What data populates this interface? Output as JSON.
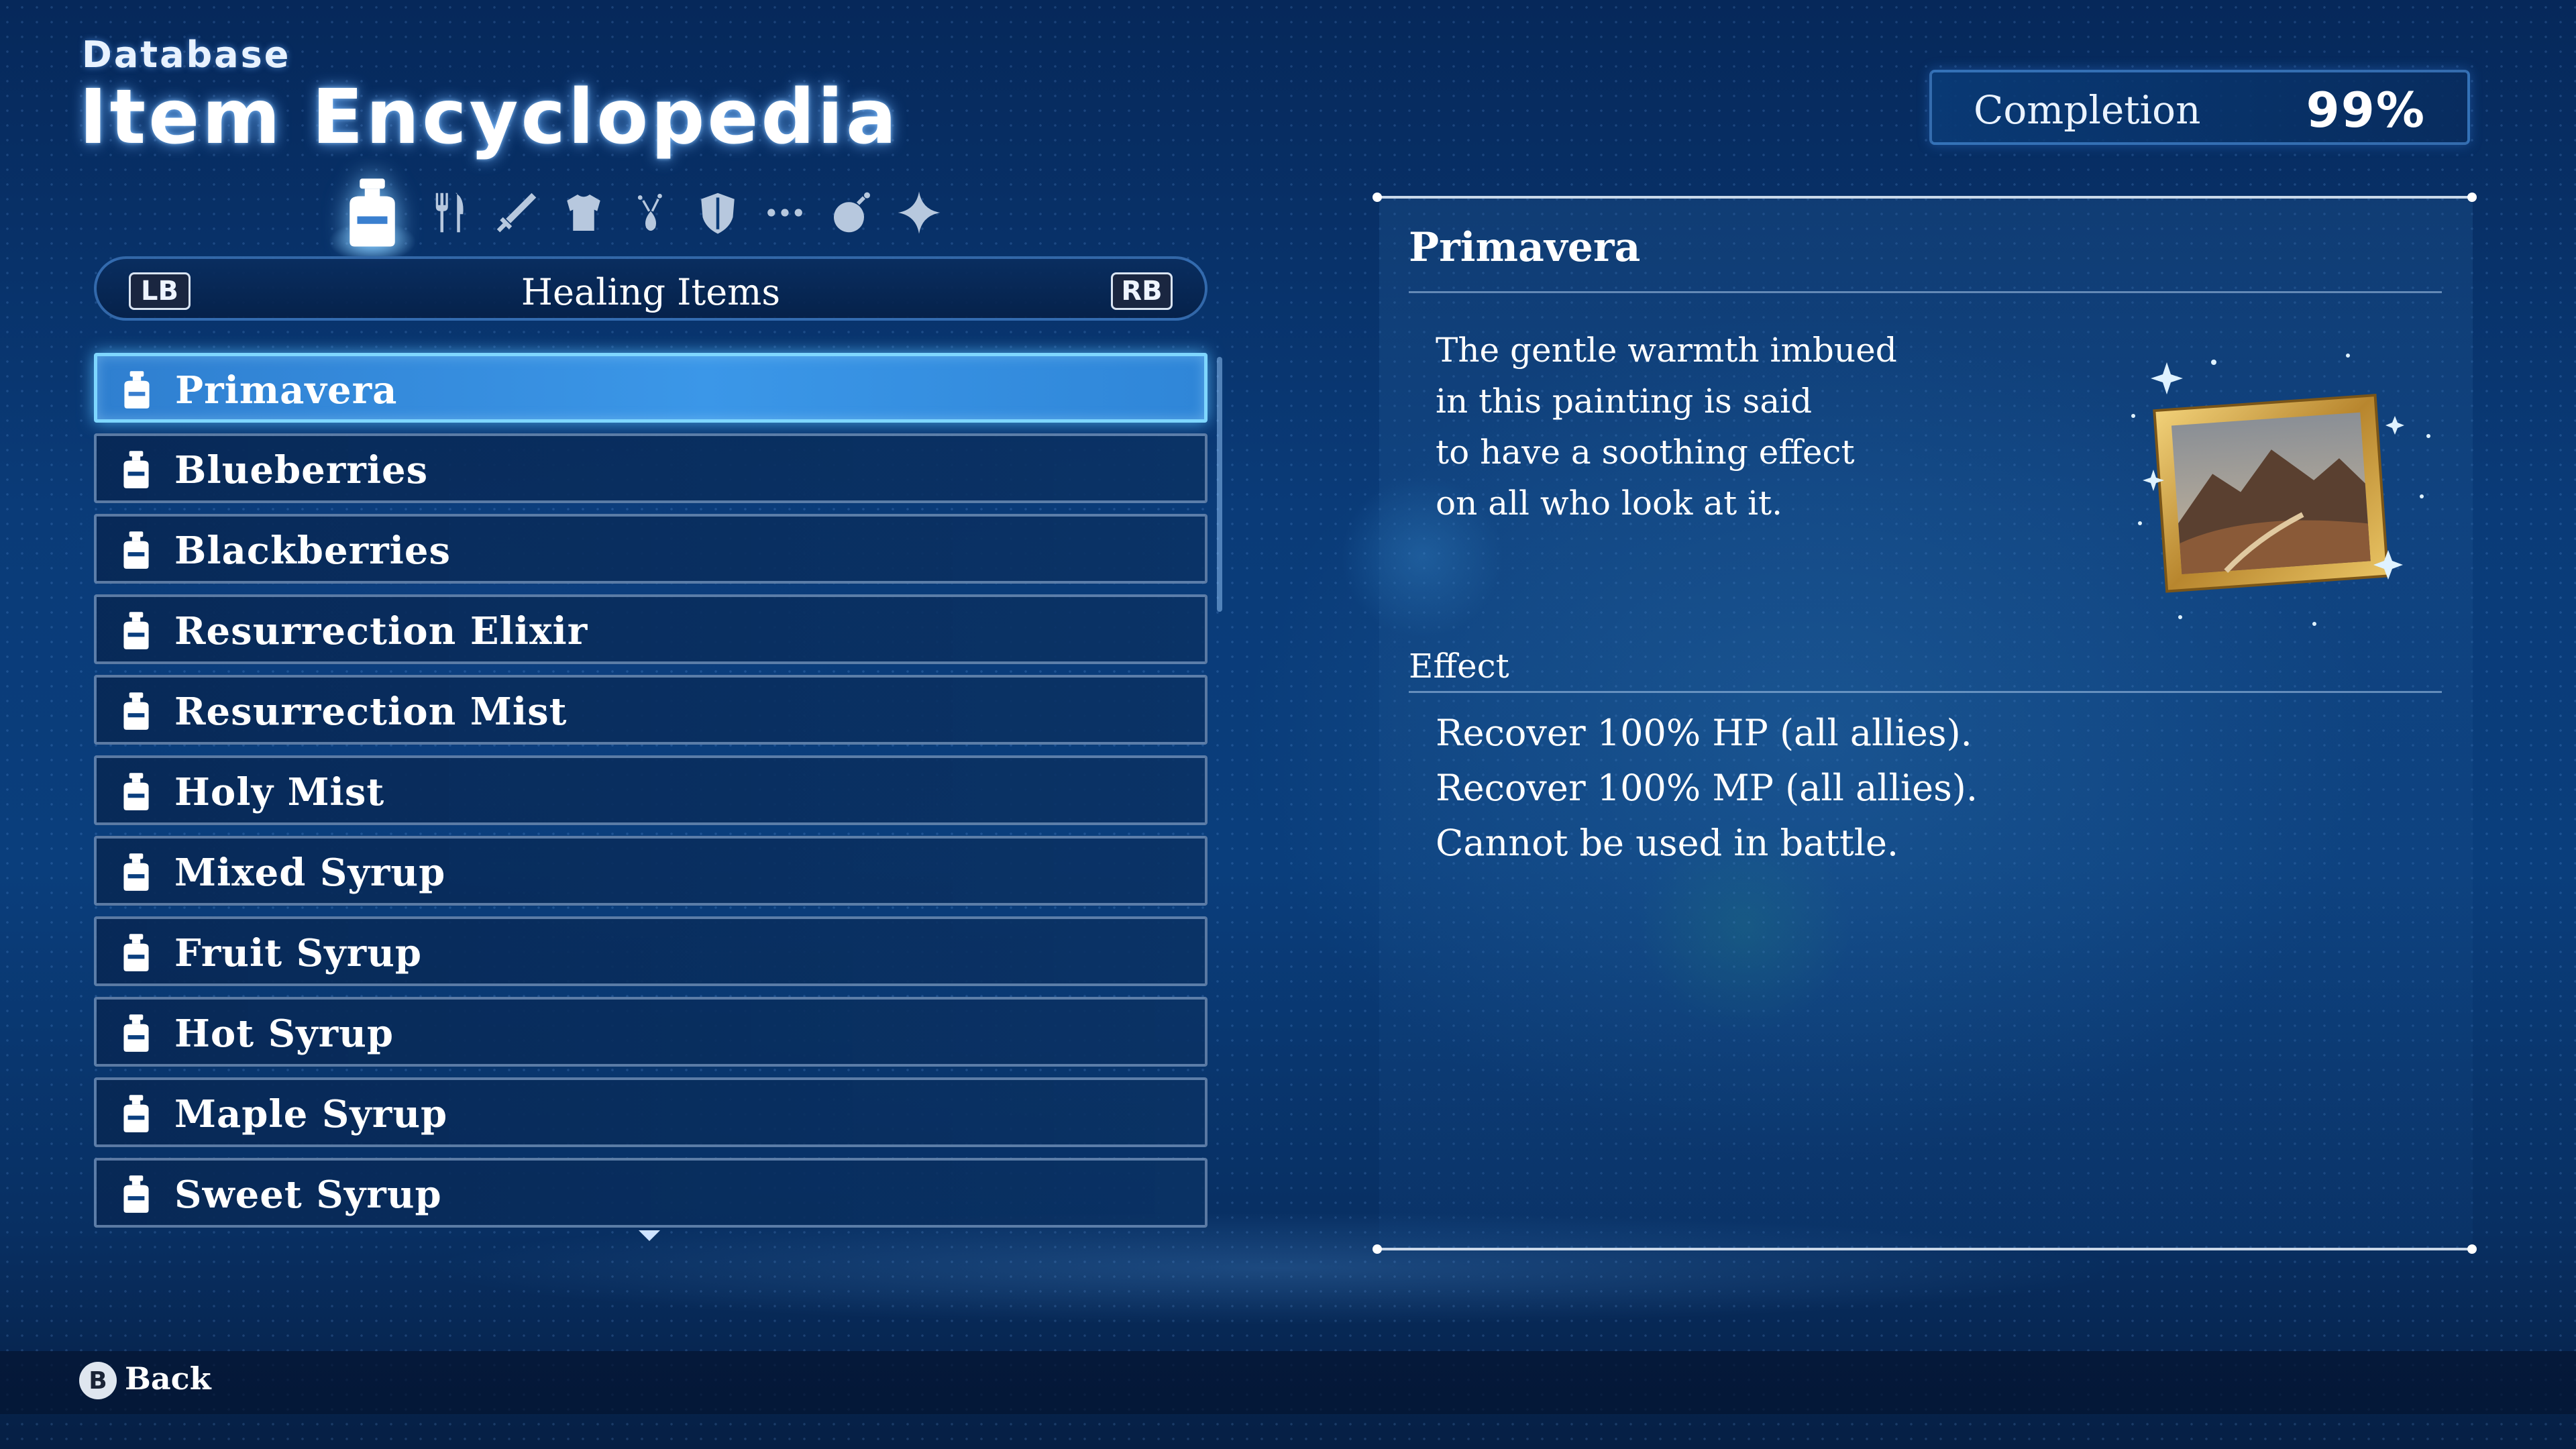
{
  "header": {
    "kicker": "Database",
    "title": "Item Encyclopedia"
  },
  "completion": {
    "label": "Completion",
    "value": "99%"
  },
  "category_tabs": [
    {
      "icon": "potion-icon",
      "active": true
    },
    {
      "icon": "fork-knife-icon",
      "active": false
    },
    {
      "icon": "sword-icon",
      "active": false
    },
    {
      "icon": "armor-icon",
      "active": false
    },
    {
      "icon": "gem-icon",
      "active": false
    },
    {
      "icon": "shield-icon",
      "active": false
    },
    {
      "icon": "ellipsis-icon",
      "active": false
    },
    {
      "icon": "bomb-icon",
      "active": false
    },
    {
      "icon": "sparkle-icon",
      "active": false
    }
  ],
  "category_bar": {
    "prev_button": "LB",
    "next_button": "RB",
    "title": "Healing Items"
  },
  "items": [
    {
      "label": "Primavera",
      "icon": "potion-icon",
      "selected": true
    },
    {
      "label": "Blueberries",
      "icon": "potion-icon",
      "selected": false
    },
    {
      "label": "Blackberries",
      "icon": "potion-icon",
      "selected": false
    },
    {
      "label": "Resurrection Elixir",
      "icon": "potion-icon",
      "selected": false
    },
    {
      "label": "Resurrection Mist",
      "icon": "potion-icon",
      "selected": false
    },
    {
      "label": "Holy Mist",
      "icon": "potion-icon",
      "selected": false
    },
    {
      "label": "Mixed Syrup",
      "icon": "potion-icon",
      "selected": false
    },
    {
      "label": "Fruit Syrup",
      "icon": "potion-icon",
      "selected": false
    },
    {
      "label": "Hot Syrup",
      "icon": "potion-icon",
      "selected": false
    },
    {
      "label": "Maple Syrup",
      "icon": "potion-icon",
      "selected": false
    },
    {
      "label": "Sweet Syrup",
      "icon": "potion-icon",
      "selected": false
    }
  ],
  "detail": {
    "name": "Primavera",
    "description": [
      "The gentle warmth imbued",
      "in this painting is said",
      "to have a soothing effect",
      "on all who look at it."
    ],
    "effect_title": "Effect",
    "effect": [
      "Recover 100% HP (all allies).",
      "Recover 100% MP (all allies).",
      "Cannot be used in battle."
    ],
    "image_icon": "framed-painting-icon"
  },
  "footer": {
    "button": "B",
    "label": "Back"
  },
  "colors": {
    "accent": "#3b97e8",
    "selected_border": "#7fd7ff",
    "background": "#0a3b78"
  }
}
